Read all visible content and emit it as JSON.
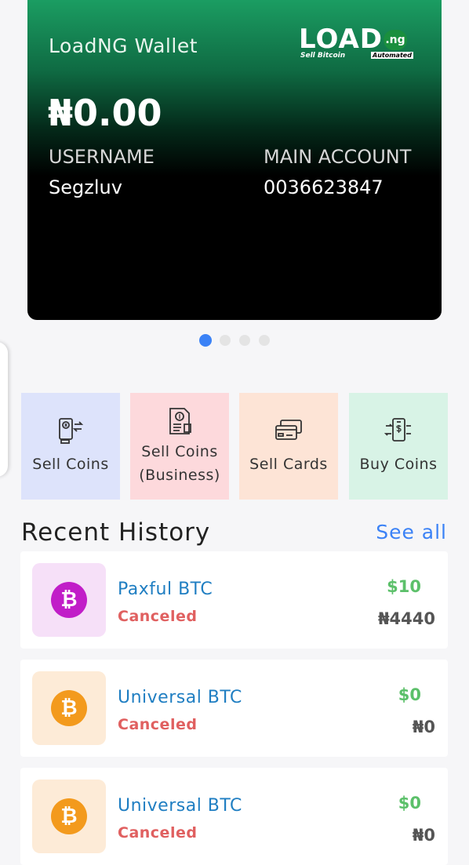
{
  "wallet": {
    "title": "LoadNG Wallet",
    "balance": "₦0.00",
    "username_label": "USERNAME",
    "username": "Segzluv",
    "account_label": "MAIN ACCOUNT",
    "account_number": "0036623847"
  },
  "logo": {
    "text": "LOAD",
    "suffix": ".ng",
    "tagline": "Sell Bitcoin",
    "badge": "Automated"
  },
  "carousel": {
    "count": 4,
    "active_index": 0
  },
  "actions": [
    {
      "label": "Sell Coins",
      "icon": "exchange-phone-icon",
      "bg": "#dde3fb"
    },
    {
      "label": "Sell Coins (Business)",
      "icon": "invoice-icon",
      "bg": "#fdd9dc"
    },
    {
      "label": "Sell Cards",
      "icon": "credit-cards-icon",
      "bg": "#fde4d6"
    },
    {
      "label": "Buy Coins",
      "icon": "mobile-payment-icon",
      "bg": "#d8f3e6"
    }
  ],
  "history": {
    "title": "Recent History",
    "see_all": "See all",
    "items": [
      {
        "name": "Paxful BTC",
        "status": "Canceled",
        "usd": "$10",
        "ngn": "₦4440",
        "icon": "bitcoin-icon",
        "thumb_bg": "#f6e0f8",
        "coin_color": "#c11ec8"
      },
      {
        "name": "Universal BTC",
        "status": "Canceled",
        "usd": "$0",
        "ngn": "₦0",
        "icon": "bitcoin-icon",
        "thumb_bg": "#fdebd7",
        "coin_color": "#f39a1d"
      },
      {
        "name": "Universal BTC",
        "status": "Canceled",
        "usd": "$0",
        "ngn": "₦0",
        "icon": "bitcoin-icon",
        "thumb_bg": "#fdebd7",
        "coin_color": "#f39a1d"
      }
    ]
  }
}
